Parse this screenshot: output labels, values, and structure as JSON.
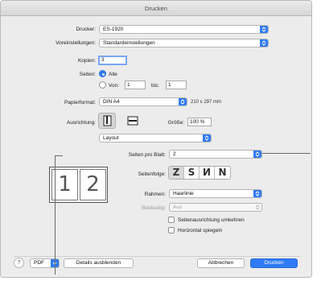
{
  "window": {
    "title": "Drucken"
  },
  "printer": {
    "label": "Drucker:",
    "value": "ES-1920"
  },
  "presets": {
    "label": "Voreinstellungen:",
    "value": "Standardeinstellungen"
  },
  "copies": {
    "label": "Kopien:",
    "value": "3"
  },
  "pages": {
    "label": "Seiten:",
    "all_label": "Alle",
    "from_label": "Von:",
    "from_value": "1",
    "to_label": "bis:",
    "to_value": "1"
  },
  "paper": {
    "label": "Papierformat:",
    "value": "DIN A4",
    "dimensions": "210 x 297 mm"
  },
  "orientation": {
    "label": "Ausrichtung:"
  },
  "scale": {
    "label": "Größe:",
    "value": "100 %"
  },
  "section": {
    "value": "Layout"
  },
  "layout": {
    "pages_per_sheet_label": "Seiten pro Blatt:",
    "pages_per_sheet_value": "2",
    "direction_label": "Seitenfolge:",
    "direction_glyphs": [
      "Z",
      "S",
      "N",
      "N"
    ],
    "border_label": "Rahmen:",
    "border_value": "Haarlinie",
    "duplex_label": "Beidseitig:",
    "duplex_value": "Aus",
    "reverse_orientation_label": "Seitenausrichtung umkehren",
    "flip_horizontal_label": "Horizontal spiegeln"
  },
  "preview": {
    "page_numbers": [
      "1",
      "2"
    ]
  },
  "footer": {
    "help": "?",
    "pdf_label": "PDF",
    "hide_details_label": "Details ausblenden",
    "cancel_label": "Abbrechen",
    "print_label": "Drucken"
  },
  "colors": {
    "accent": "#2f7bf5",
    "dialog_bg": "#ececec"
  }
}
